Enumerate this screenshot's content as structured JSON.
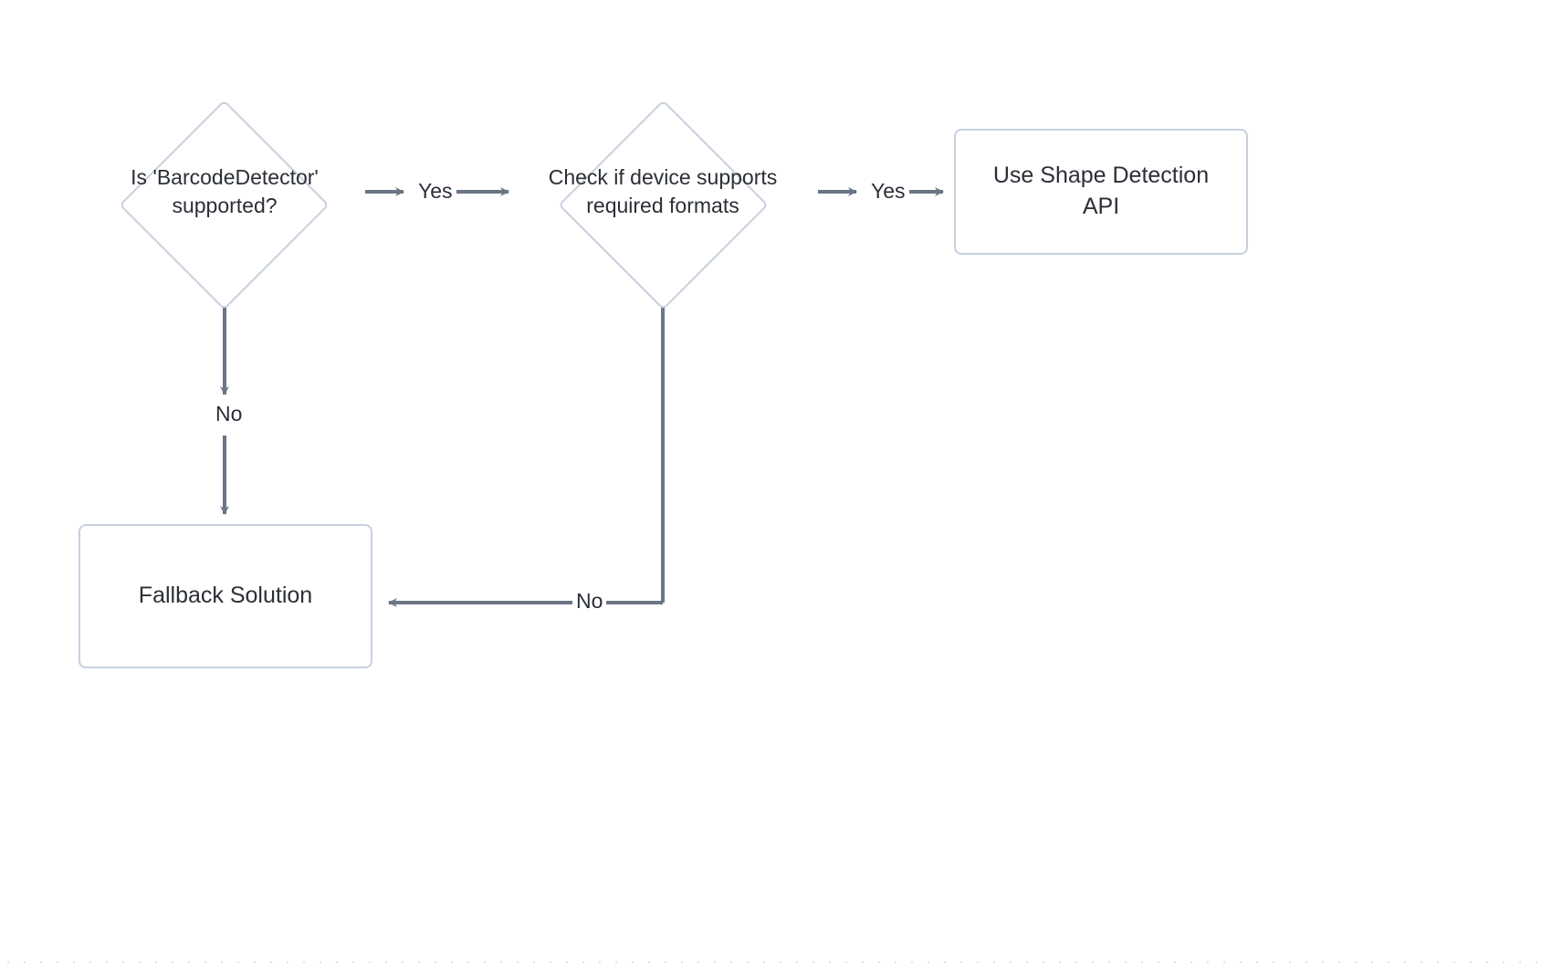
{
  "nodes": {
    "decision1": {
      "line1": "Is 'BarcodeDetector'",
      "line2": "supported?"
    },
    "decision2": {
      "line1": "Check if device supports",
      "line2": "required formats"
    },
    "result_api": {
      "line1": "Use Shape Detection",
      "line2": "API"
    },
    "fallback": "Fallback Solution"
  },
  "edges": {
    "d1_yes": "Yes",
    "d1_no": "No",
    "d2_yes": "Yes",
    "d2_no": "No"
  },
  "style": {
    "arrow_color": "#6a7585",
    "box_border": "#c7d0de",
    "text_color": "#2b2f36"
  }
}
